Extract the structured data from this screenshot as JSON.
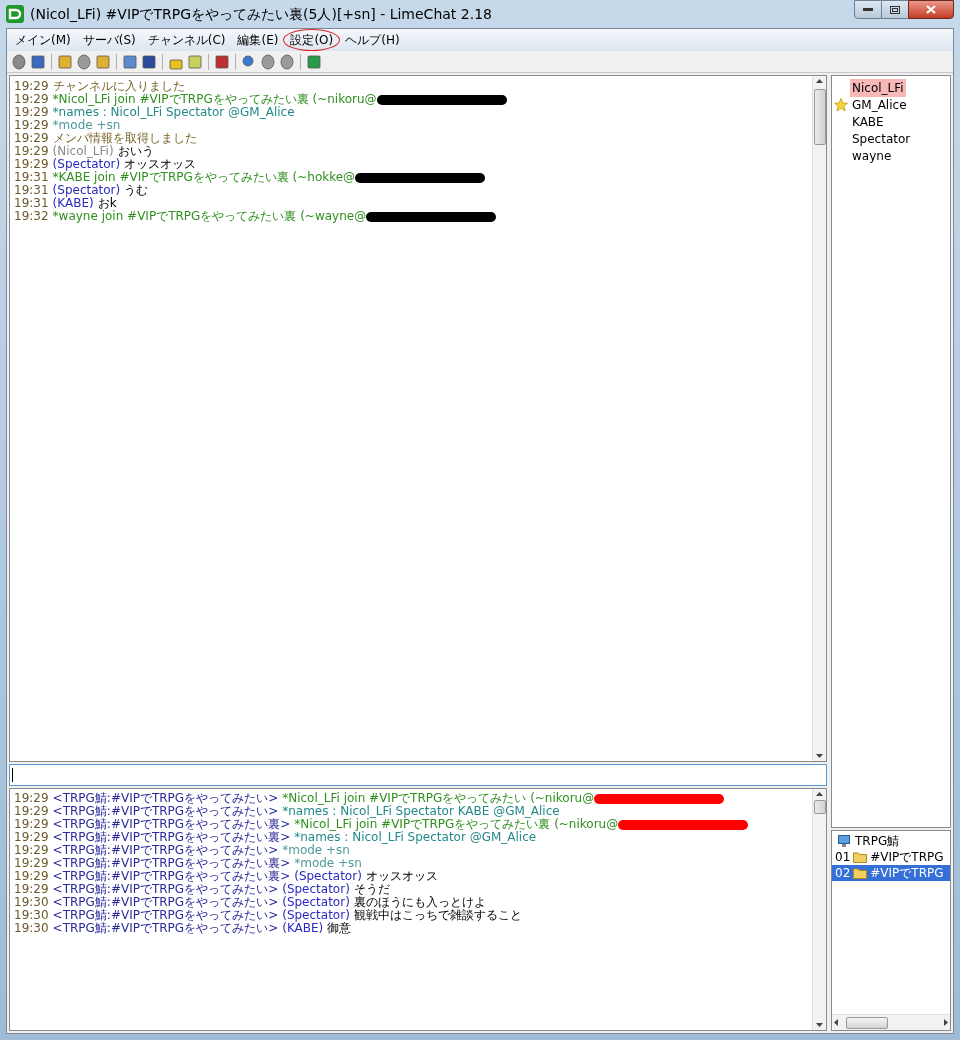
{
  "window": {
    "title": "(Nicol_LFi) #VIPでTRPGをやってみたい裏(5人)[+sn]  - LimeChat 2.18"
  },
  "menu": [
    {
      "label": "メイン(M)",
      "circled": false
    },
    {
      "label": "サーバ(S)",
      "circled": false
    },
    {
      "label": "チャンネル(C)",
      "circled": false
    },
    {
      "label": "編集(E)",
      "circled": false
    },
    {
      "label": "設定(O)",
      "circled": true
    },
    {
      "label": "ヘルプ(H)",
      "circled": false
    }
  ],
  "channel_log": [
    {
      "time": "19:29",
      "parts": [
        {
          "kind": "system",
          "text": "チャンネルに入りました"
        }
      ],
      "redacted": false
    },
    {
      "time": "19:29",
      "parts": [
        {
          "kind": "join",
          "text": "*Nicol_LFi join #VIPでTRPGをやってみたい裏 (~nikoru@"
        }
      ],
      "redacted": true
    },
    {
      "time": "19:29",
      "parts": [
        {
          "kind": "names",
          "text": "*names : Nicol_LFi Spectator @GM_Alice"
        }
      ],
      "redacted": false
    },
    {
      "time": "19:29",
      "parts": [
        {
          "kind": "mode",
          "text": "*mode +sn"
        }
      ],
      "redacted": false
    },
    {
      "time": "19:29",
      "parts": [
        {
          "kind": "system",
          "text": "メンバ情報を取得しました"
        }
      ],
      "redacted": false
    },
    {
      "time": "19:29",
      "parts": [
        {
          "kind": "mynick",
          "text": "(Nicol_LFi)"
        },
        {
          "kind": "text",
          "text": "おいう"
        }
      ],
      "redacted": false
    },
    {
      "time": "19:29",
      "parts": [
        {
          "kind": "nick",
          "text": "(Spectator)"
        },
        {
          "kind": "text",
          "text": "オッスオッス"
        }
      ],
      "redacted": false
    },
    {
      "time": "19:31",
      "parts": [
        {
          "kind": "join",
          "text": "*KABE join #VIPでTRPGをやってみたい裏 (~hokke@"
        }
      ],
      "redacted": true
    },
    {
      "time": "19:31",
      "parts": [
        {
          "kind": "nick",
          "text": "(Spectator)"
        },
        {
          "kind": "text",
          "text": "うむ"
        }
      ],
      "redacted": false
    },
    {
      "time": "19:31",
      "parts": [
        {
          "kind": "nick",
          "text": "(KABE)"
        },
        {
          "kind": "text",
          "text": "おk"
        }
      ],
      "redacted": false
    },
    {
      "time": "19:32",
      "parts": [
        {
          "kind": "join",
          "text": "*wayne join #VIPでTRPGをやってみたい裏 (~wayne@"
        }
      ],
      "redacted": true
    }
  ],
  "console_log": [
    {
      "time": "19:29",
      "parts": [
        {
          "kind": "channel",
          "text": "<TRPG鯖:#VIPでTRPGをやってみたい>"
        },
        {
          "kind": "join",
          "text": "*Nicol_LFi join #VIPでTRPGをやってみたい (~nikoru@"
        }
      ],
      "redacted": true
    },
    {
      "time": "19:29",
      "parts": [
        {
          "kind": "channel",
          "text": "<TRPG鯖:#VIPでTRPGをやってみたい>"
        },
        {
          "kind": "names",
          "text": "*names : Nicol_LFi Spectator KABE @GM_Alice"
        }
      ],
      "redacted": false
    },
    {
      "time": "19:29",
      "parts": [
        {
          "kind": "channel",
          "text": "<TRPG鯖:#VIPでTRPGをやってみたい裏>"
        },
        {
          "kind": "join",
          "text": "*Nicol_LFi join #VIPでTRPGをやってみたい裏 (~nikoru@"
        }
      ],
      "redacted": true
    },
    {
      "time": "19:29",
      "parts": [
        {
          "kind": "channel",
          "text": "<TRPG鯖:#VIPでTRPGをやってみたい裏>"
        },
        {
          "kind": "names",
          "text": "*names : Nicol_LFi Spectator @GM_Alice"
        }
      ],
      "redacted": false
    },
    {
      "time": "19:29",
      "parts": [
        {
          "kind": "channel",
          "text": "<TRPG鯖:#VIPでTRPGをやってみたい>"
        },
        {
          "kind": "mode",
          "text": "*mode +sn"
        }
      ],
      "redacted": false
    },
    {
      "time": "19:29",
      "parts": [
        {
          "kind": "channel",
          "text": "<TRPG鯖:#VIPでTRPGをやってみたい裏>"
        },
        {
          "kind": "mode",
          "text": "*mode +sn"
        }
      ],
      "redacted": false
    },
    {
      "time": "19:29",
      "parts": [
        {
          "kind": "channel",
          "text": "<TRPG鯖:#VIPでTRPGをやってみたい裏>"
        },
        {
          "kind": "nick",
          "text": "(Spectator)"
        },
        {
          "kind": "text",
          "text": "オッスオッス"
        }
      ],
      "redacted": false
    },
    {
      "time": "19:29",
      "parts": [
        {
          "kind": "channel",
          "text": "<TRPG鯖:#VIPでTRPGをやってみたい>"
        },
        {
          "kind": "nick",
          "text": "(Spectator)"
        },
        {
          "kind": "text",
          "text": "そうだ"
        }
      ],
      "redacted": false
    },
    {
      "time": "19:30",
      "parts": [
        {
          "kind": "channel",
          "text": "<TRPG鯖:#VIPでTRPGをやってみたい>"
        },
        {
          "kind": "nick",
          "text": "(Spectator)"
        },
        {
          "kind": "text",
          "text": "裏のほうにも入っとけよ"
        }
      ],
      "redacted": false
    },
    {
      "time": "19:30",
      "parts": [
        {
          "kind": "channel",
          "text": "<TRPG鯖:#VIPでTRPGをやってみたい>"
        },
        {
          "kind": "nick",
          "text": "(Spectator)"
        },
        {
          "kind": "text",
          "text": "観戦中はこっちで雑談すること"
        }
      ],
      "redacted": false
    },
    {
      "time": "19:30",
      "parts": [
        {
          "kind": "channel",
          "text": "<TRPG鯖:#VIPでTRPGをやってみたい>"
        },
        {
          "kind": "nick",
          "text": "(KABE)"
        },
        {
          "kind": "text",
          "text": "御意"
        }
      ],
      "redacted": false
    }
  ],
  "members": [
    {
      "name": "Nicol_LFi",
      "self": true,
      "op": false
    },
    {
      "name": "GM_Alice",
      "self": false,
      "op": true
    },
    {
      "name": "KABE",
      "self": false,
      "op": false
    },
    {
      "name": "Spectator",
      "self": false,
      "op": false
    },
    {
      "name": "wayne",
      "self": false,
      "op": false
    }
  ],
  "server_tree": [
    {
      "label": "TRPG鯖",
      "children": [
        {
          "number": "01",
          "label": "#VIPでTRPG",
          "selected": false
        },
        {
          "number": "02",
          "label": "#VIPでTRPG",
          "selected": true
        }
      ]
    }
  ]
}
